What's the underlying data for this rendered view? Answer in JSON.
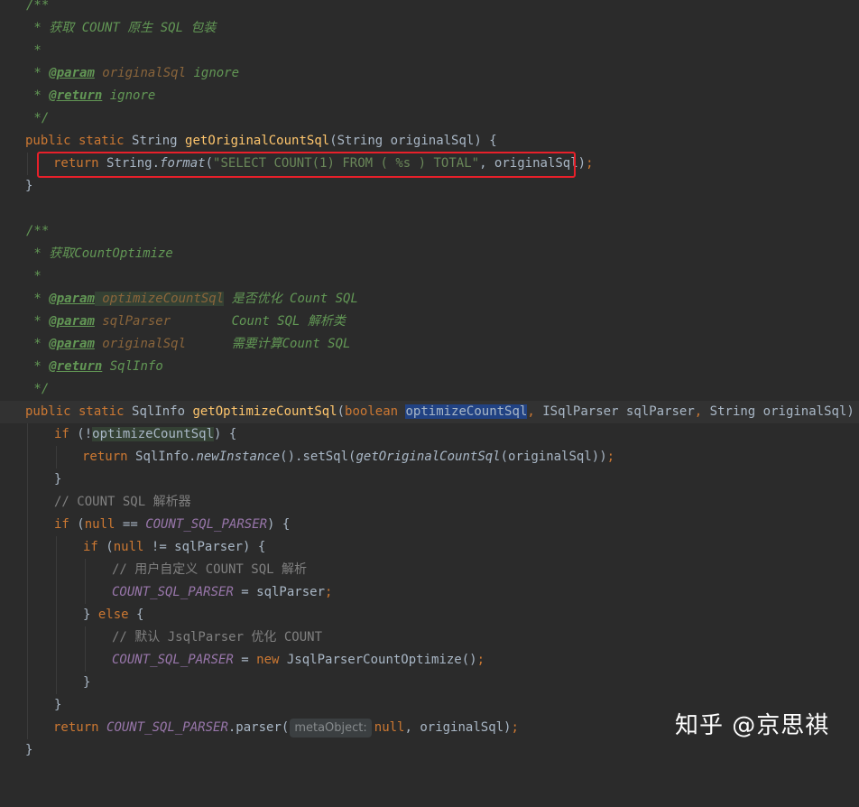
{
  "editor": {
    "lines": [
      {
        "t": "/**"
      },
      {
        "t": " * 获取 COUNT 原生 SQL 包装"
      },
      {
        "t": " *"
      },
      {
        "p1": " * ",
        "tag": "@param",
        "pn": " originalSql",
        "rest": " ignore"
      },
      {
        "p1": " * ",
        "tag": "@return",
        "rest": " ignore"
      },
      {
        "t": " */"
      },
      {
        "kw": "public static ",
        "ty": "String ",
        "fn": "getOriginalCountSql",
        "a": "(String originalSql) {"
      },
      {
        "kw": "return ",
        "a": "String.",
        "it": "format",
        "b": "(",
        "st": "\"SELECT COUNT(1) FROM ( %s ) TOTAL\"",
        "c": ", originalSql)",
        "d": ";"
      },
      {
        "t": "}"
      },
      {
        "t": ""
      },
      {
        "t": "/**"
      },
      {
        "t": " * 获取CountOptimize"
      },
      {
        "t": " *"
      },
      {
        "p1": " * ",
        "tag": "@param",
        "pn": " optimizeCountSql",
        "rest": " 是否优化 Count SQL"
      },
      {
        "p1": " * ",
        "tag": "@param",
        "pn": " sqlParser",
        "rest": "        Count SQL 解析类"
      },
      {
        "p1": " * ",
        "tag": "@param",
        "pn": " originalSql",
        "rest": "      需要计算Count SQL"
      },
      {
        "p1": " * ",
        "tag": "@return",
        "rest": " SqlInfo"
      },
      {
        "t": " */"
      },
      {
        "kw": "public static ",
        "ty": "SqlInfo ",
        "fn": "getOptimizeCountSql",
        "a": "(",
        "kw2": "boolean ",
        "sel": "optimizeCountSql",
        "c1": ",",
        "ty2": " ISqlParser sqlParser",
        "c2": ",",
        "ty3": " String originalSql) {"
      },
      {
        "kw": "if ",
        "a": "(!",
        "hl": "optimizeCountSql",
        "b": ") {"
      },
      {
        "kw": "return ",
        "a": "SqlInfo.",
        "it": "newInstance",
        "b": "().setSql(",
        "it2": "getOriginalCountSql",
        "c": "(originalSql))",
        "d": ";"
      },
      {
        "t": "}"
      },
      {
        "t": "// COUNT SQL 解析器"
      },
      {
        "kw": "if ",
        "a": "(",
        "kw2": "null ",
        "b": "== ",
        "cst": "COUNT_SQL_PARSER",
        "c": ") {"
      },
      {
        "kw": "if ",
        "a": "(",
        "kw2": "null ",
        "b": "!= sqlParser) {"
      },
      {
        "t": "// 用户自定义 COUNT SQL 解析"
      },
      {
        "cst": "COUNT_SQL_PARSER",
        "a": " = sqlParser",
        "d": ";"
      },
      {
        "a": "} ",
        "kw": "else ",
        "b": "{"
      },
      {
        "t": "// 默认 JsqlParser 优化 COUNT"
      },
      {
        "cst": "COUNT_SQL_PARSER",
        "a": " = ",
        "kw": "new ",
        "b": "JsqlParserCountOptimize()",
        "d": ";"
      },
      {
        "t": "}"
      },
      {
        "t": "}"
      },
      {
        "kw": "return ",
        "cst": "COUNT_SQL_PARSER",
        "a": ".parser(",
        "hint": "metaObject:",
        "kw2": "null",
        "c": ", originalSql)",
        "d": ";"
      },
      {
        "t": "}"
      }
    ]
  },
  "watermark": "知乎 @京思祺",
  "colors": {
    "background": "#2b2b2b",
    "keyword": "#cc7832",
    "method": "#ffc66d",
    "string": "#6a8759",
    "doc_comment": "#629755",
    "constant": "#9876aa",
    "highlight_box": "#e8202a"
  }
}
